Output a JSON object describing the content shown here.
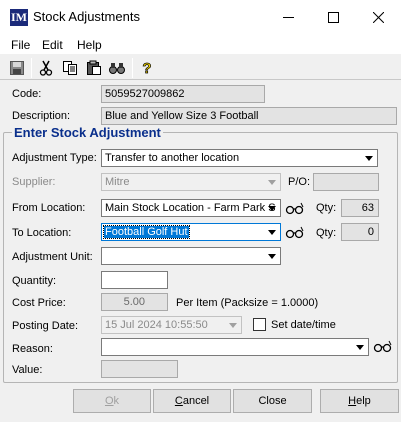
{
  "window": {
    "icon_text": "IM",
    "title": "Stock Adjustments"
  },
  "menu": [
    "File",
    "Edit",
    "Help"
  ],
  "toolbar": {
    "icons": [
      "save-icon",
      "cut-icon",
      "copy-icon",
      "paste-icon",
      "find-icon",
      "help-icon"
    ]
  },
  "header": {
    "code_label": "Code:",
    "code_value": "5059527009862",
    "description_label": "Description:",
    "description_value": "Blue and Yellow Size 3 Football"
  },
  "group": {
    "title": "Enter Stock Adjustment",
    "adjustment_type_label": "Adjustment Type:",
    "adjustment_type_value": "Transfer to another location",
    "supplier_label": "Supplier:",
    "supplier_value": "Mitre",
    "po_label": "P/O:",
    "po_value": "",
    "from_location_label": "From Location:",
    "from_location_value": "Main Stock Location - Farm Park S",
    "from_qty_label": "Qty:",
    "from_qty_value": "63",
    "to_location_label": "To  Location:",
    "to_location_value": "Football Golf Hut",
    "to_qty_label": "Qty:",
    "to_qty_value": "0",
    "adjustment_unit_label": "Adjustment Unit:",
    "adjustment_unit_value": "",
    "quantity_label": "Quantity:",
    "quantity_value": "",
    "cost_price_label": "Cost Price:",
    "cost_price_value": "5.00",
    "per_item_text": "Per Item (Packsize = 1.0000)",
    "posting_date_label": "Posting Date:",
    "posting_date_value": "15  Jul  2024 10:55:50",
    "set_datetime_label": "Set date/time",
    "reason_label": "Reason:",
    "reason_value": "",
    "value_label": "Value:",
    "value_value": ""
  },
  "buttons": {
    "ok_mnemonic": "O",
    "ok_rest": "k",
    "cancel_mnemonic": "C",
    "cancel_rest": "ancel",
    "close_label": "Close",
    "help_mnemonic": "H",
    "help_rest": "elp"
  },
  "colors": {
    "group_title": "#0a2f8c",
    "selection": "#0078d7",
    "app_icon": "#1b2a7a"
  }
}
